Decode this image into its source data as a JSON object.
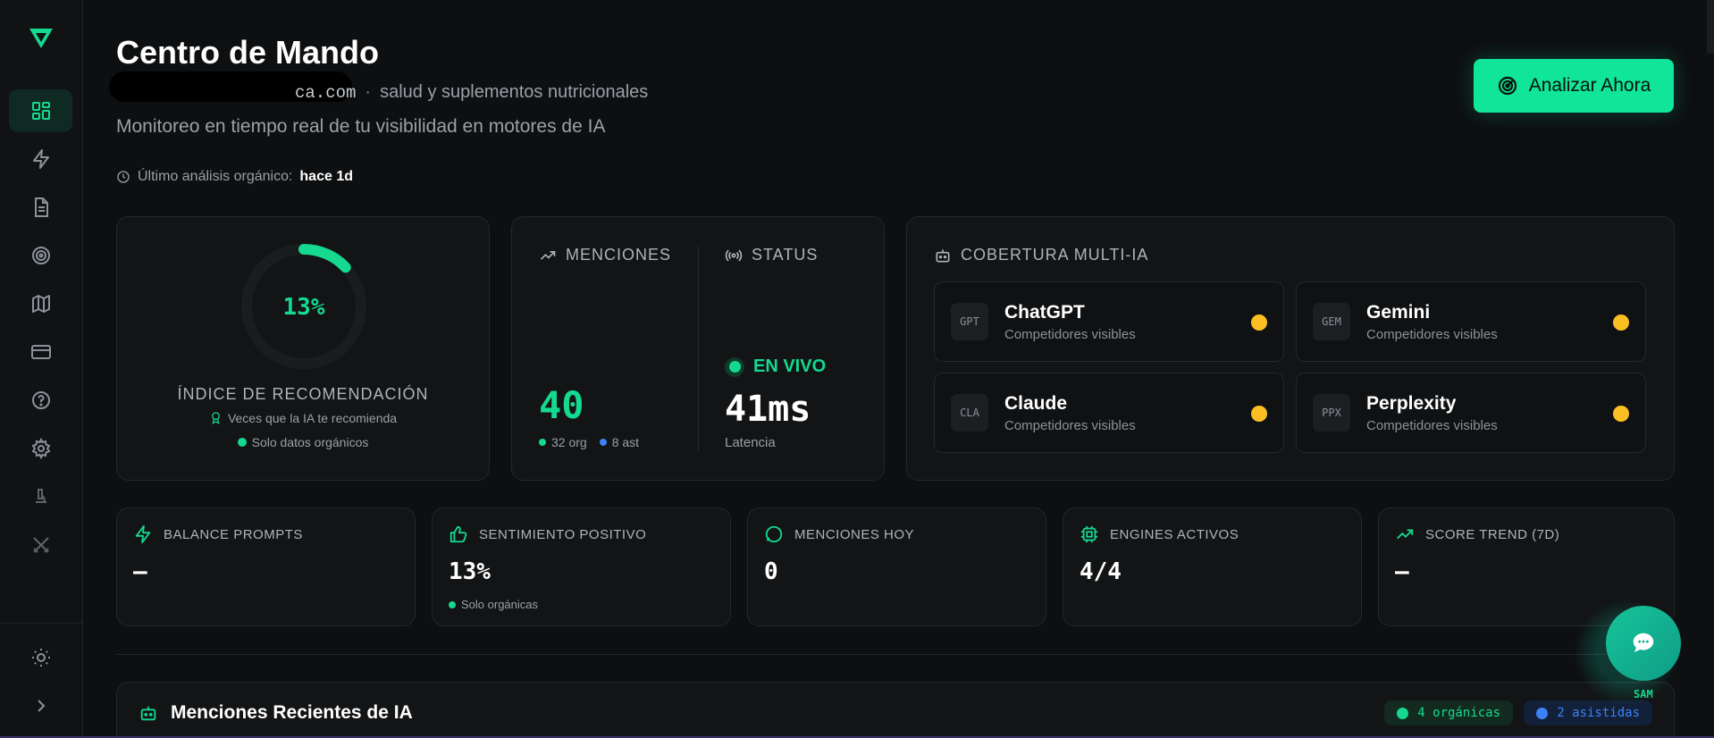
{
  "header": {
    "title": "Centro de Mando",
    "domain": "ca.com",
    "separator": "·",
    "industry": "salud y suplementos nutricionales",
    "subtitle": "Monitoreo en tiempo real de tu visibilidad en motores de IA",
    "last_analysis_label": "Último análisis orgánico:",
    "last_analysis_value": "hace 1d",
    "analyze_button": "Analizar Ahora"
  },
  "sidebar": {
    "items": [
      {
        "icon": "dashboard-icon",
        "active": true
      },
      {
        "icon": "lightning-icon"
      },
      {
        "icon": "document-icon"
      },
      {
        "icon": "target-icon"
      },
      {
        "icon": "map-icon"
      },
      {
        "icon": "credit-card-icon"
      },
      {
        "icon": "help-icon"
      },
      {
        "icon": "gear-icon"
      },
      {
        "icon": "microscope-icon"
      },
      {
        "icon": "crossed-swords-icon"
      }
    ],
    "bottom": [
      {
        "icon": "sun-icon"
      },
      {
        "icon": "chevron-right-icon"
      }
    ]
  },
  "recommendation": {
    "value": "13%",
    "fraction": 0.13,
    "label": "ÍNDICE DE RECOMENDACIÓN",
    "sub": "Veces que la IA te recomienda",
    "note": "Solo datos orgánicos"
  },
  "mentions": {
    "label": "MENCIONES",
    "value": "40",
    "org": "32 org",
    "ast": "8 ast"
  },
  "status": {
    "label": "STATUS",
    "live": "EN VIVO",
    "latency": "41ms",
    "latency_label": "Latencia"
  },
  "coverage": {
    "label": "COBERTURA MULTI-IA",
    "engines": [
      {
        "badge": "GPT",
        "name": "ChatGPT",
        "status": "Competidores visibles"
      },
      {
        "badge": "GEM",
        "name": "Gemini",
        "status": "Competidores visibles"
      },
      {
        "badge": "CLA",
        "name": "Claude",
        "status": "Competidores visibles"
      },
      {
        "badge": "PPX",
        "name": "Perplexity",
        "status": "Competidores visibles"
      }
    ],
    "status_color": "#fbbf24"
  },
  "stats": [
    {
      "label": "BALANCE PROMPTS",
      "value": "—",
      "icon": "lightning-icon"
    },
    {
      "label": "SENTIMIENTO POSITIVO",
      "value": "13%",
      "sub": "Solo orgánicas",
      "icon": "thumbs-up-icon"
    },
    {
      "label": "MENCIONES HOY",
      "value": "0",
      "icon": "chat-bubble-icon"
    },
    {
      "label": "ENGINES ACTIVOS",
      "value": "4/4",
      "icon": "cpu-icon"
    },
    {
      "label": "SCORE TREND (7D)",
      "value": "—",
      "icon": "trend-up-icon"
    }
  ],
  "recent": {
    "title": "Menciones Recientes de IA",
    "organic": "4 orgánicas",
    "assisted": "2 asistidas"
  },
  "chat": {
    "label": "SAM"
  },
  "colors": {
    "accent": "#10e59a",
    "green": "#14d98f",
    "blue": "#3b82f6",
    "amber": "#fbbf24",
    "background": "#0d0f11"
  }
}
